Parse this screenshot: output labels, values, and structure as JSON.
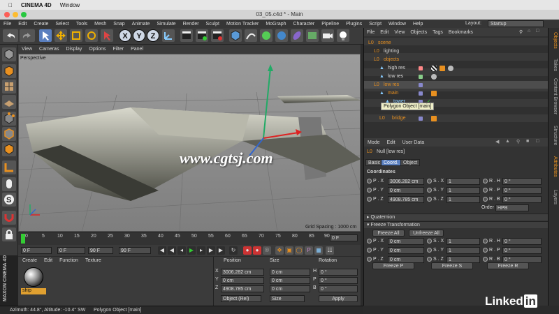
{
  "mac_menu": {
    "app": "CINEMA 4D",
    "window": "Window"
  },
  "window_title": "03_05.c4d * - Main",
  "menubar": {
    "items": [
      "File",
      "Edit",
      "Create",
      "Select",
      "Tools",
      "Mesh",
      "Snap",
      "Animate",
      "Simulate",
      "Render",
      "Sculpt",
      "Motion Tracker",
      "MoGraph",
      "Character",
      "Pipeline",
      "Plugins",
      "Script",
      "Window",
      "Help"
    ],
    "layout_label": "Layout:",
    "layout_value": "Startup"
  },
  "toolbar": {
    "x": "X",
    "y": "Y",
    "z": "Z"
  },
  "view_menu": [
    "View",
    "Cameras",
    "Display",
    "Options",
    "Filter",
    "Panel"
  ],
  "viewport": {
    "camera": "Perspective",
    "grid_spacing": "Grid Spacing : 1000 cm",
    "watermark": "www.cgtsj.com"
  },
  "timeline": {
    "ticks": [
      "0",
      "5",
      "10",
      "15",
      "20",
      "25",
      "30",
      "35",
      "40",
      "45",
      "50",
      "55",
      "60",
      "65",
      "70",
      "75",
      "80",
      "85",
      "90"
    ],
    "end_frame": "0 F"
  },
  "transport": {
    "current": "0 F",
    "min": "0 F",
    "max": "90 F",
    "end": "90 F"
  },
  "material": {
    "menu": [
      "Create",
      "Edit",
      "Function",
      "Texture"
    ],
    "name": "ship"
  },
  "coords": {
    "headers": [
      "Position",
      "Size",
      "Rotation"
    ],
    "rows": [
      {
        "axis": "X",
        "pos": "3006.282 cm",
        "size": "0 cm",
        "rot_axis": "H",
        "rot": "0 °"
      },
      {
        "axis": "Y",
        "pos": "0 cm",
        "size": "0 cm",
        "rot_axis": "P",
        "rot": "0 °"
      },
      {
        "axis": "Z",
        "pos": "4908.785 cm",
        "size": "0 cm",
        "rot_axis": "B",
        "rot": "0 °"
      }
    ],
    "mode1": "Object (Rel)",
    "mode2": "Size",
    "apply": "Apply"
  },
  "status": {
    "azimuth": "Azimuth: 44.8°, Altitude: -10.4°  SW",
    "object": "Polygon Object [main]"
  },
  "maxon": "MAXON CINEMA 4D",
  "objects": {
    "menu": [
      "File",
      "Edit",
      "View",
      "Objects",
      "Tags",
      "Bookmarks"
    ],
    "items": [
      "scene",
      "lighting",
      "objects",
      "high res",
      "low res",
      "low res",
      "main",
      "tower",
      "bridge"
    ],
    "tooltip": "Polygon Object [main]"
  },
  "attributes": {
    "menu": [
      "Mode",
      "Edit",
      "User Data"
    ],
    "title": "Null [low res]",
    "tabs": [
      "Basic",
      "Coord.",
      "Object"
    ],
    "section": "Coordinates",
    "coords": [
      {
        "a": "P . X",
        "v": "3006.282 cm",
        "sa": "S . X",
        "sv": "1",
        "ra": "R . H",
        "rv": "0 °"
      },
      {
        "a": "P . Y",
        "v": "0 cm",
        "sa": "S . Y",
        "sv": "1",
        "ra": "R . P",
        "rv": "0 °"
      },
      {
        "a": "P . Z",
        "v": "4908.785 cm",
        "sa": "S . Z",
        "sv": "1",
        "ra": "R . B",
        "rv": "0 °"
      }
    ],
    "order_label": "Order",
    "order": "HPB",
    "quaternion": "▸ Quaternion",
    "freeze": "▾ Freeze Transformation",
    "freeze_all": "Freeze All",
    "unfreeze_all": "Unfreeze All",
    "freeze_coords": [
      {
        "a": "P . X",
        "v": "0 cm",
        "sa": "S . X",
        "sv": "1",
        "ra": "R . H",
        "rv": "0 °"
      },
      {
        "a": "P . Y",
        "v": "0 cm",
        "sa": "S . Y",
        "sv": "1",
        "ra": "R . P",
        "rv": "0 °"
      },
      {
        "a": "P . Z",
        "v": "0 cm",
        "sa": "S . Z",
        "sv": "1",
        "ra": "R . B",
        "rv": "0 °"
      }
    ],
    "freeze_p": "Freeze P",
    "freeze_s": "Freeze S",
    "freeze_r": "Freeze R"
  },
  "right_tabs": [
    "Objects",
    "Takes",
    "Content Browser",
    "Structure",
    "Attributes",
    "Layers"
  ],
  "branding": {
    "linked": "Linked",
    "in": "in"
  }
}
